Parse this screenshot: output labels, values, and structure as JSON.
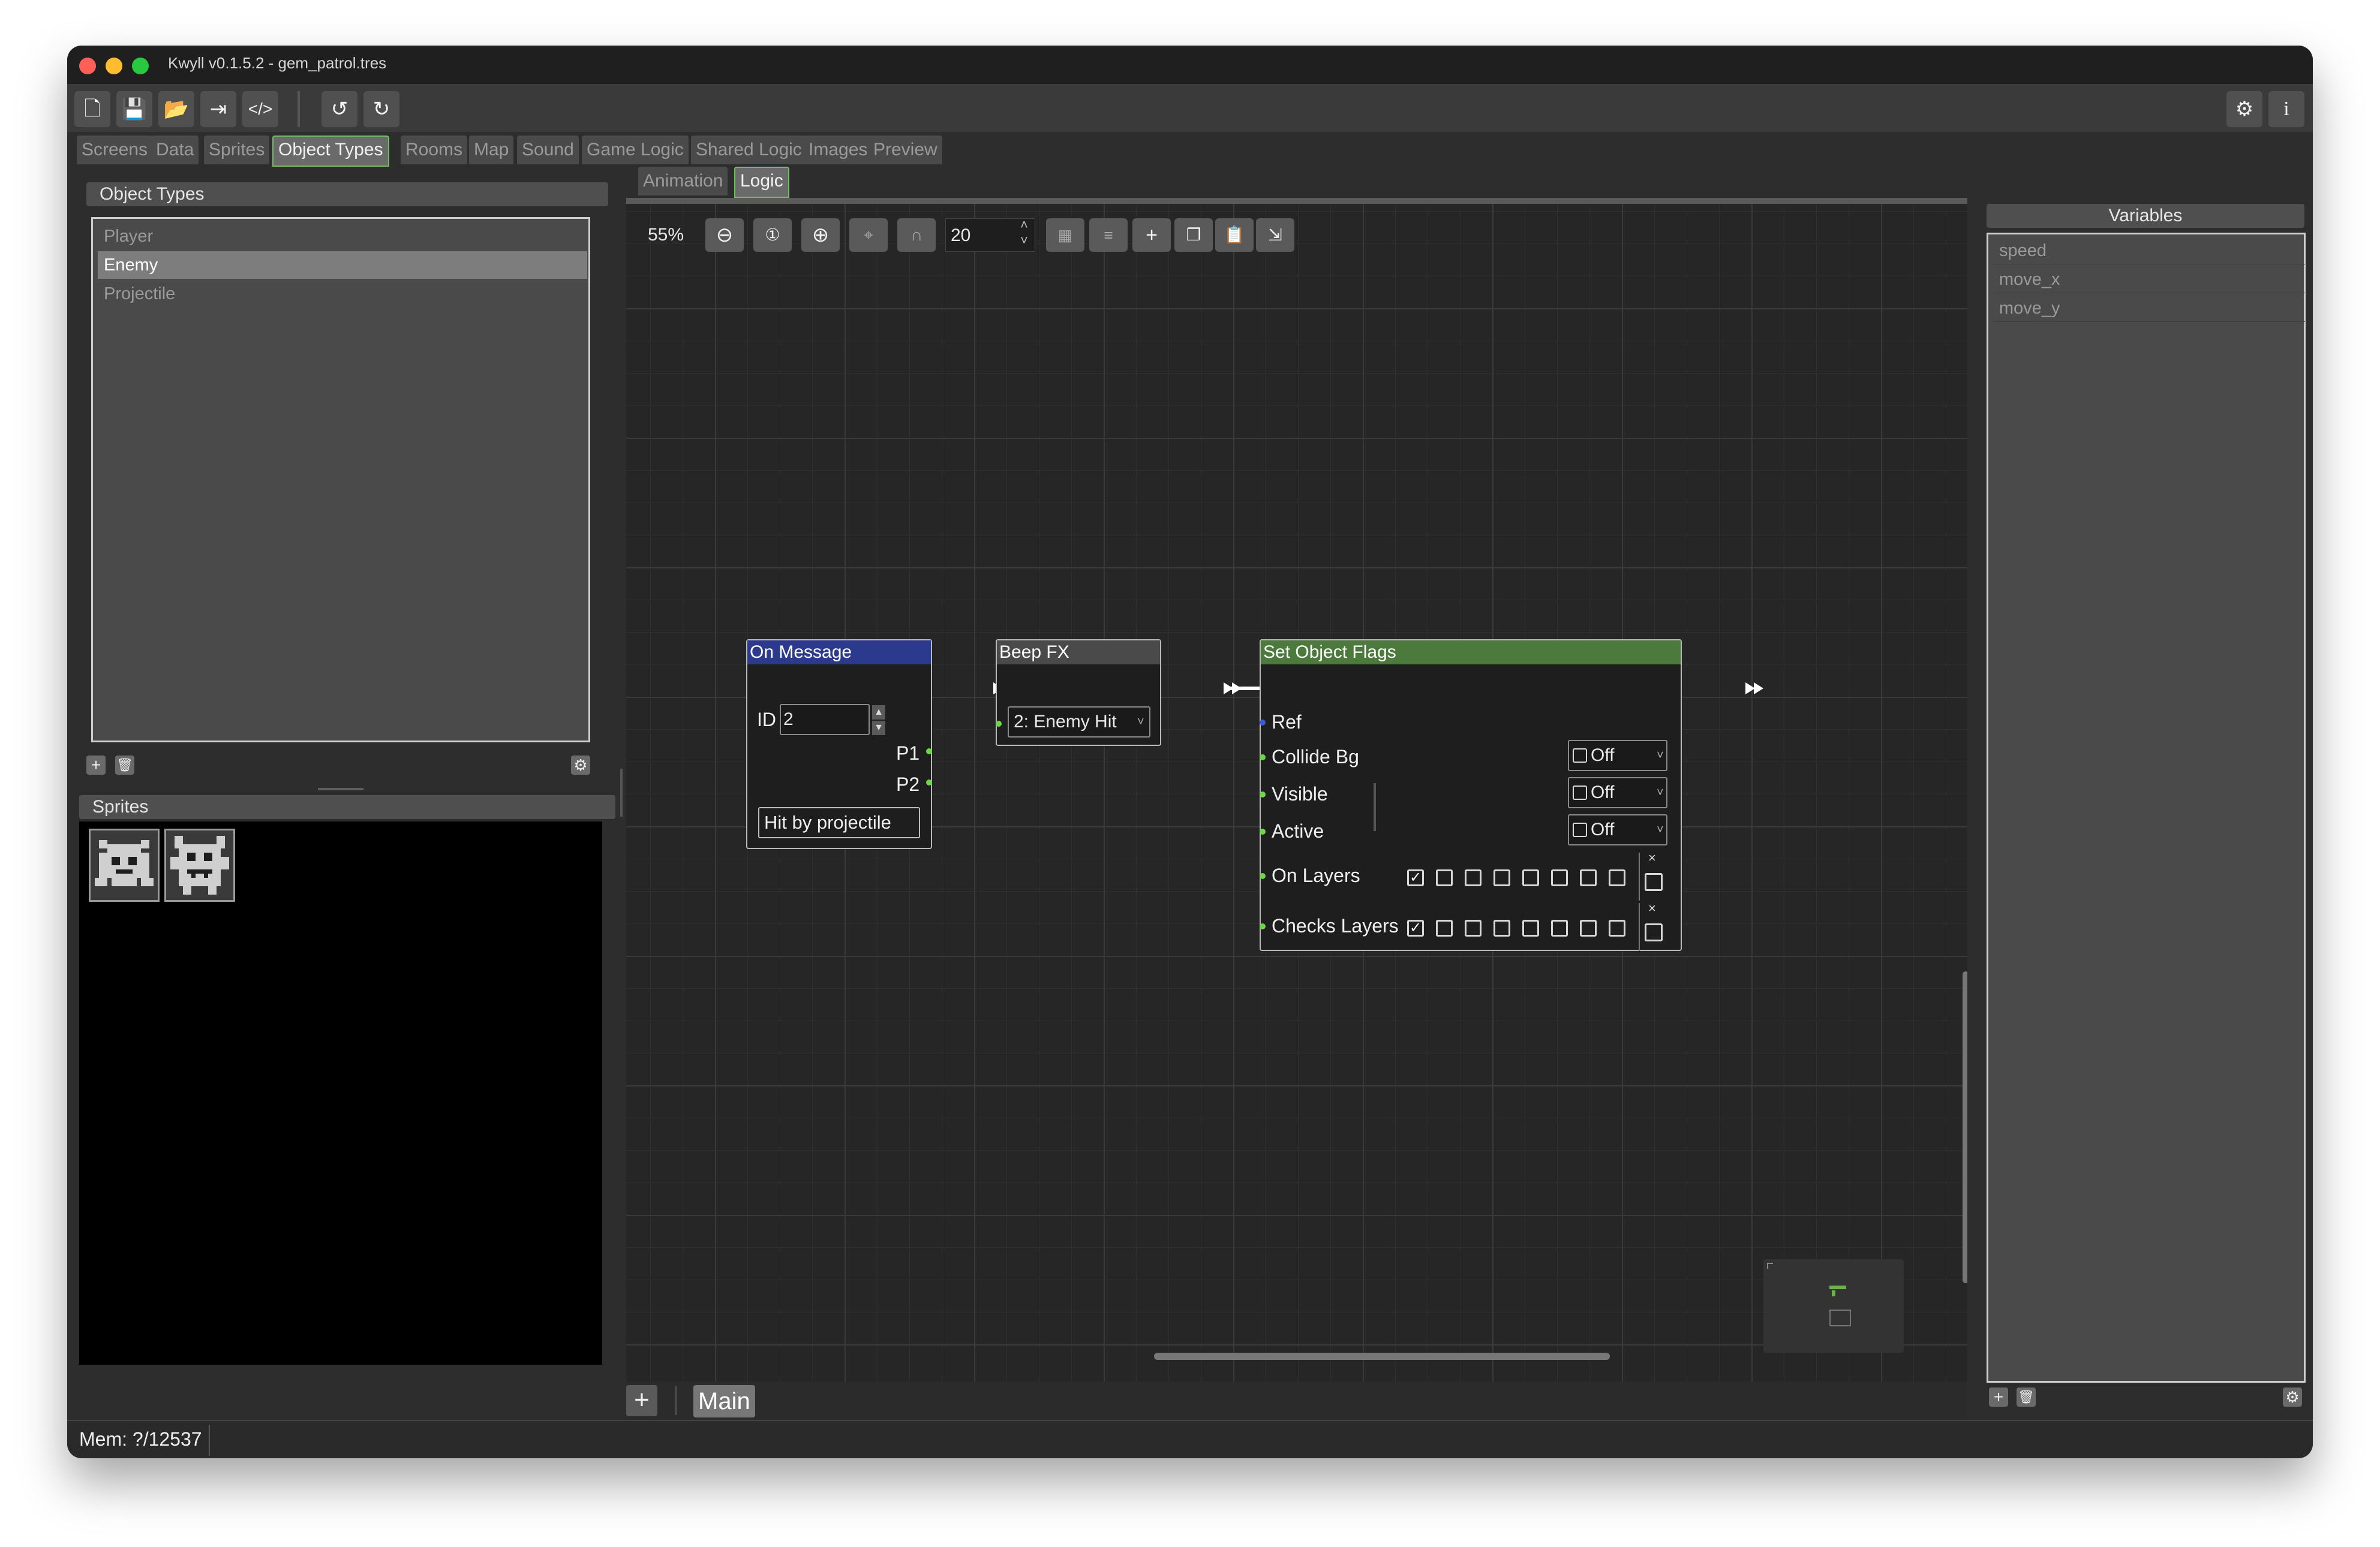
{
  "window": {
    "title": "Kwyll v0.1.5.2 - gem_patrol.tres",
    "traffic_lights": {
      "close": "#ff5f57",
      "minimize": "#febc2e",
      "zoom": "#28c840"
    }
  },
  "toolbar": {
    "icons": [
      "new-file-icon",
      "save-icon",
      "open-folder-icon",
      "export-icon",
      "code-icon",
      "undo-icon",
      "redo-icon",
      "settings-icon",
      "info-icon"
    ],
    "code_glyph": "</>",
    "info_glyph": "i"
  },
  "main_tabs": [
    {
      "label": "Screens",
      "active": false
    },
    {
      "label": "Data",
      "active": false
    },
    {
      "label": "Sprites",
      "active": false
    },
    {
      "label": "Object Types",
      "active": true
    },
    {
      "label": "Rooms",
      "active": false
    },
    {
      "label": "Map",
      "active": false
    },
    {
      "label": "Sound",
      "active": false
    },
    {
      "label": "Game Logic",
      "active": false
    },
    {
      "label": "Shared Logic",
      "active": false
    },
    {
      "label": "Images",
      "active": false
    },
    {
      "label": "Preview",
      "active": false
    }
  ],
  "object_types": {
    "header": "Object Types",
    "items": [
      {
        "label": "Player",
        "selected": false
      },
      {
        "label": "Enemy",
        "selected": true
      },
      {
        "label": "Projectile",
        "selected": false
      }
    ]
  },
  "sprites": {
    "header": "Sprites",
    "thumbnails": [
      "enemy-crab-sprite",
      "enemy-face-sprite"
    ]
  },
  "sub_tabs": [
    {
      "label": "Animation",
      "active": false
    },
    {
      "label": "Logic",
      "active": true
    }
  ],
  "canvas_toolbar": {
    "zoom": "55%",
    "grid_value": "20"
  },
  "nodes": {
    "on_message": {
      "title": "On Message",
      "title_color": "#2b3a8c",
      "id_label": "ID",
      "id_value": "2",
      "p1": "P1",
      "p2": "P2",
      "button": "Hit by projectile"
    },
    "beep_fx": {
      "title": "Beep FX",
      "title_color": "#4a4a4a",
      "sound": "2: Enemy Hit"
    },
    "set_flags": {
      "title": "Set Object Flags",
      "title_color": "#4b7a3c",
      "ref": "Ref",
      "collide_bg": "Collide Bg",
      "collide_bg_value": "Off",
      "visible": "Visible",
      "visible_value": "Off",
      "active": "Active",
      "active_value": "Off",
      "on_layers": "On Layers",
      "checks_layers": "Checks Layers",
      "on_layers_checked": [
        true,
        false,
        false,
        false,
        false,
        false,
        false,
        false
      ],
      "checks_layers_checked": [
        true,
        false,
        false,
        false,
        false,
        false,
        false,
        false
      ],
      "clear_mark": "×"
    }
  },
  "bottom_tabs": {
    "add": "+",
    "main": "Main"
  },
  "variables": {
    "header": "Variables",
    "items": [
      "speed",
      "move_x",
      "move_y"
    ]
  },
  "status": {
    "mem": "Mem: ?/12537"
  },
  "colors": {
    "accent_green": "#6fd64a",
    "tab_active_border": "#78b86a"
  }
}
